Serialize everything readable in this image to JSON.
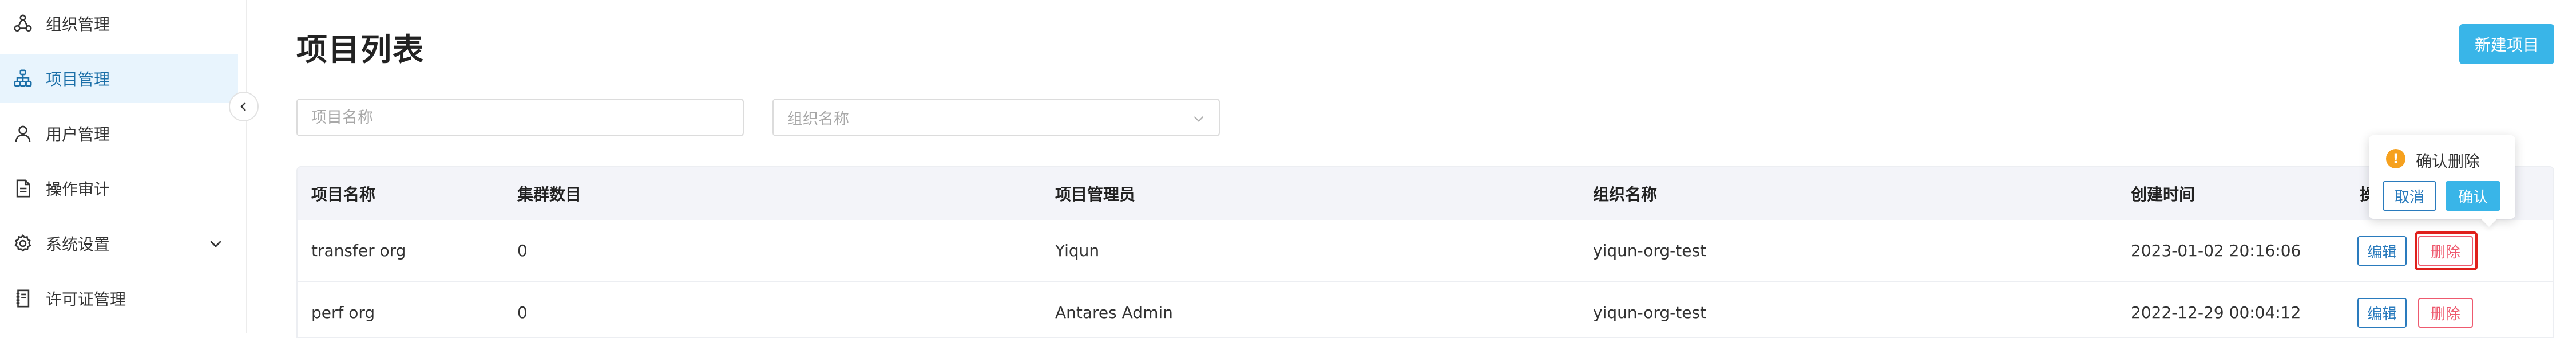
{
  "sidebar": {
    "items": [
      {
        "label": "组织管理",
        "icon": "organization-icon",
        "active": false
      },
      {
        "label": "项目管理",
        "icon": "project-tree-icon",
        "active": true
      },
      {
        "label": "用户管理",
        "icon": "user-icon",
        "active": false
      },
      {
        "label": "操作审计",
        "icon": "audit-document-icon",
        "active": false
      },
      {
        "label": "系统设置",
        "icon": "gear-icon",
        "active": false
      },
      {
        "label": "许可证管理",
        "icon": "license-icon",
        "active": false
      }
    ],
    "colors": {
      "active_bg": "#e8f4fd",
      "active_text": "#1b6fa8"
    }
  },
  "header": {
    "title": "项目列表",
    "new_button": "新建项目"
  },
  "filters": {
    "project_name_placeholder": "项目名称",
    "org_select_placeholder": "组织名称"
  },
  "table": {
    "columns": [
      "项目名称",
      "集群数目",
      "项目管理员",
      "组织名称",
      "创建时间",
      "操作"
    ],
    "rows": [
      {
        "name": "transfer org",
        "clusters": "0",
        "admin": "Yiqun",
        "org": "yiqun-org-test",
        "created": "2023-01-02 20:16:06"
      },
      {
        "name": "perf org",
        "clusters": "0",
        "admin": "Antares Admin",
        "org": "yiqun-org-test",
        "created": "2022-12-29 00:04:12"
      }
    ],
    "actions": {
      "edit": "编辑",
      "delete": "删除"
    }
  },
  "popconfirm": {
    "title": "确认删除",
    "cancel": "取消",
    "confirm": "确认"
  },
  "colors": {
    "primary": "#39b5e8",
    "link_blue": "#2a7bbd",
    "danger": "#ee5a6f",
    "warning": "#f6a11e",
    "highlight_red": "#e0201c"
  }
}
